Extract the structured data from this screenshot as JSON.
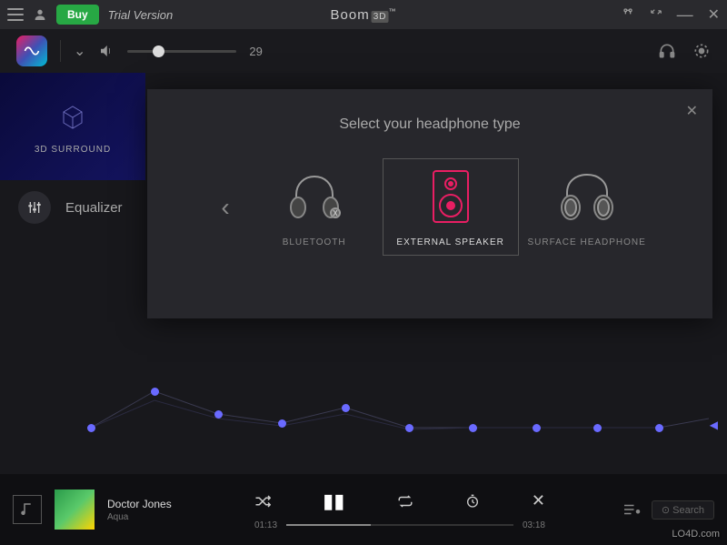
{
  "titlebar": {
    "buy_label": "Buy",
    "trial_label": "Trial Version",
    "app_name": "Boom",
    "app_badge": "3D",
    "tm": "™"
  },
  "toolbar": {
    "volume_value": "29"
  },
  "surround": {
    "label": "3D SURROUND"
  },
  "equalizer": {
    "label": "Equalizer"
  },
  "dialog": {
    "title": "Select your headphone type",
    "options": [
      {
        "label": "BLUETOOTH"
      },
      {
        "label": "EXTERNAL SPEAKER",
        "selected": true
      },
      {
        "label": "SURFACE HEADPHONE"
      }
    ]
  },
  "player": {
    "track_title": "Doctor Jones",
    "track_artist": "Aqua",
    "elapsed": "01:13",
    "duration": "03:18",
    "search_placeholder": "Search"
  },
  "watermark": "LO4D.com"
}
